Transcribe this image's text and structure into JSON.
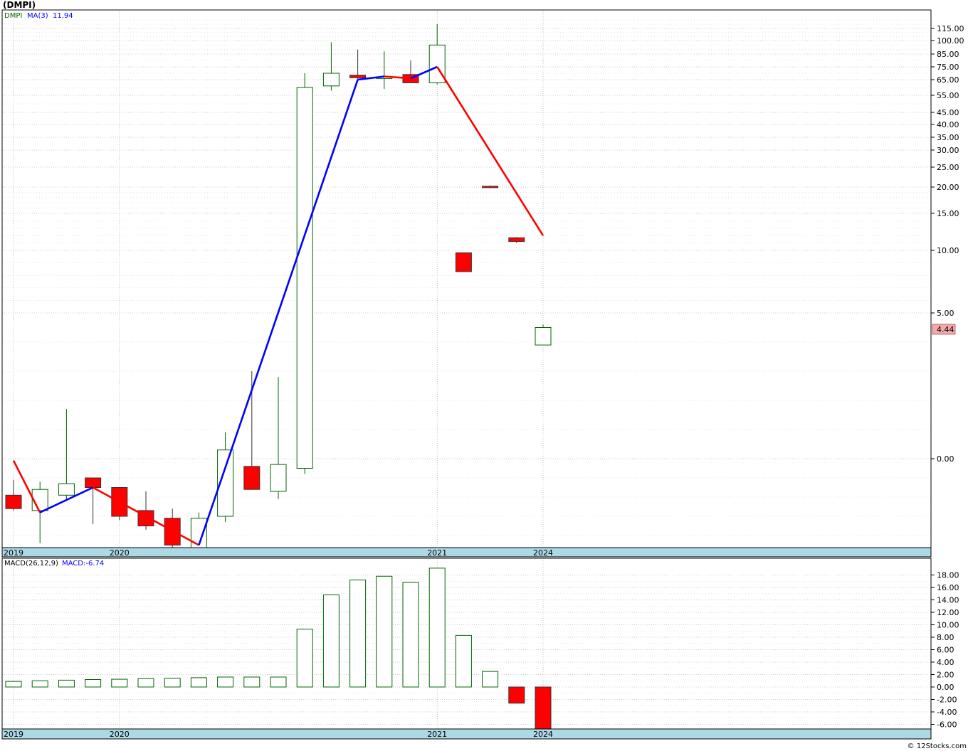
{
  "title": "(DMPI)",
  "copyright": "© 12Stocks.com",
  "colors": {
    "up": "#006400",
    "down": "#ff0000",
    "ma_up": "#0000ff",
    "ma_down": "#ff0000",
    "axis_band": "#add8e6",
    "grid": "#999999",
    "price_badge": "#f4a9a9"
  },
  "chart_data": [
    {
      "type": "candlestick",
      "name": "price",
      "legend": {
        "symbol": "DMPI",
        "ma_label": "MA(3)",
        "ma_value": "11.94"
      },
      "x_axis_labels": [
        "2019",
        "2020",
        "2021",
        "2024"
      ],
      "y_ticks": [
        "115.00",
        "100.00",
        "85.00",
        "75.00",
        "65.00",
        "55.00",
        "45.00",
        "40.00",
        "35.00",
        "30.00",
        "25.00",
        "20.00",
        "15.00",
        "10.00",
        "5.00",
        "0.00"
      ],
      "last_price_label": "4.44",
      "grid": true,
      "candles": [
        {
          "o": -1.9,
          "h": -1.1,
          "l": -2.7,
          "c": -2.6
        },
        {
          "o": -2.7,
          "h": -1.2,
          "l": -4.4,
          "c": -1.6
        },
        {
          "o": -1.9,
          "h": 1.7,
          "l": -2.2,
          "c": -1.3
        },
        {
          "o": -1.0,
          "h": -1.0,
          "l": -3.4,
          "c": -1.5
        },
        {
          "o": -1.5,
          "h": -1.5,
          "l": -3.2,
          "c": -3.0
        },
        {
          "o": -2.7,
          "h": -1.7,
          "l": -3.7,
          "c": -3.5
        },
        {
          "o": -3.1,
          "h": -2.6,
          "l": -4.8,
          "c": -4.5
        },
        {
          "o": -4.7,
          "h": -2.8,
          "l": -4.8,
          "c": -3.1
        },
        {
          "o": -3.0,
          "h": 0.9,
          "l": -3.3,
          "c": 0.3
        },
        {
          "o": -0.4,
          "h": 3.0,
          "l": -1.6,
          "c": -1.6
        },
        {
          "o": -1.7,
          "h": 2.8,
          "l": -2.1,
          "c": -0.3
        },
        {
          "o": -0.5,
          "h": 70,
          "l": -0.8,
          "c": 60
        },
        {
          "o": 61,
          "h": 98,
          "l": 58,
          "c": 70
        },
        {
          "o": 68.5,
          "h": 90,
          "l": 65,
          "c": 66.5
        },
        {
          "o": 66,
          "h": 88,
          "l": 59,
          "c": 67
        },
        {
          "o": 69,
          "h": 80,
          "l": 64,
          "c": 63
        },
        {
          "o": 63,
          "h": 120,
          "l": 62,
          "c": 95
        },
        {
          "o": 9.8,
          "h": 9.8,
          "l": 8.3,
          "c": 8.3
        },
        {
          "o": 20.2,
          "h": 20.4,
          "l": 19.8,
          "c": 19.9
        },
        {
          "o": 11.7,
          "h": 11.8,
          "l": 11.0,
          "c": 11.2
        },
        {
          "o": 3.9,
          "h": 4.6,
          "l": 3.9,
          "c": 4.5
        }
      ],
      "ma_segments": [
        {
          "x": [
            0,
            1
          ],
          "y": [
            -0.1,
            -2.8
          ],
          "color": "down"
        },
        {
          "x": [
            1,
            3
          ],
          "y": [
            -2.8,
            -1.5
          ],
          "color": "up"
        },
        {
          "x": [
            3,
            7
          ],
          "y": [
            -1.5,
            -4.5
          ],
          "color": "down"
        },
        {
          "x": [
            7,
            13
          ],
          "y": [
            -4.5,
            65
          ],
          "color": "up"
        },
        {
          "x": [
            13,
            14
          ],
          "y": [
            65,
            67.5
          ],
          "color": "up"
        },
        {
          "x": [
            14,
            15
          ],
          "y": [
            67.5,
            66
          ],
          "color": "down"
        },
        {
          "x": [
            15,
            16
          ],
          "y": [
            66,
            75
          ],
          "color": "up"
        },
        {
          "x": [
            16,
            20
          ],
          "y": [
            75,
            12
          ],
          "color": "down"
        }
      ]
    },
    {
      "type": "bar",
      "name": "macd",
      "legend": {
        "label": "MACD(26,12,9)",
        "value_label": "MACD:-6.74"
      },
      "x_axis_labels": [
        "2019",
        "2020",
        "2021",
        "2024"
      ],
      "y_ticks": [
        "18.00",
        "16.00",
        "14.00",
        "12.00",
        "10.00",
        "8.00",
        "6.00",
        "4.00",
        "2.00",
        "0.00",
        "-2.00",
        "-4.00",
        "-6.00"
      ],
      "ylim": [
        -6.74,
        19.2
      ],
      "grid": true,
      "values": [
        0.9,
        1.0,
        1.1,
        1.2,
        1.25,
        1.35,
        1.4,
        1.5,
        1.6,
        1.6,
        1.6,
        9.3,
        14.8,
        17.2,
        17.8,
        16.8,
        19.1,
        8.3,
        2.5,
        -2.6,
        -6.74
      ]
    }
  ]
}
